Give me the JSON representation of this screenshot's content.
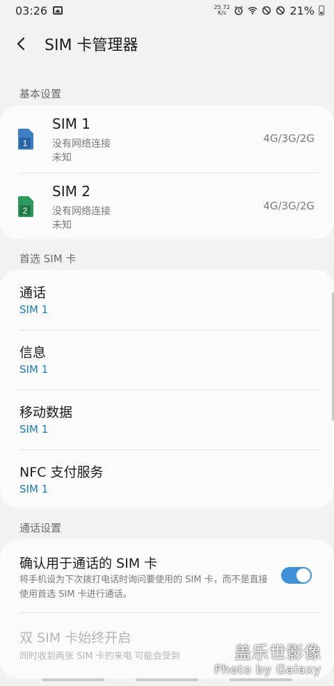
{
  "status_bar": {
    "time": "03:26",
    "net_speed_value": "25.72",
    "net_speed_unit": "K/s",
    "battery_percent": "21%"
  },
  "header": {
    "title": "SIM 卡管理器"
  },
  "sections": {
    "basic": "基本设置",
    "preferred": "首选 SIM 卡",
    "call": "通话设置"
  },
  "sims": [
    {
      "name": "SIM 1",
      "slot_number": "1",
      "status": "没有网络连接",
      "operator": "未知",
      "network": "4G/3G/2G",
      "color": "#3b7ec4"
    },
    {
      "name": "SIM 2",
      "slot_number": "2",
      "status": "没有网络连接",
      "operator": "未知",
      "network": "4G/3G/2G",
      "color": "#2e9a5e"
    }
  ],
  "preferred": [
    {
      "label": "通话",
      "value": "SIM 1"
    },
    {
      "label": "信息",
      "value": "SIM 1"
    },
    {
      "label": "移动数据",
      "value": "SIM 1"
    },
    {
      "label": "NFC 支付服务",
      "value": "SIM 1"
    }
  ],
  "call_settings": {
    "confirm_label": "确认用于通话的 SIM 卡",
    "confirm_desc": "将手机设为下次拨打电话时询问要使用的 SIM 卡，而不是直接使用首选 SIM 卡进行通话。",
    "confirm_enabled": true,
    "dual_label": "双 SIM 卡始终开启",
    "dual_desc": "同时收到两张 SIM 卡的来电 可能会受到"
  },
  "watermark": {
    "line1": "盖乐世影像",
    "line2": "Photo by Galaxy"
  },
  "colors": {
    "accent": "#1b7cb8",
    "toggle_on": "#3e91d6"
  }
}
